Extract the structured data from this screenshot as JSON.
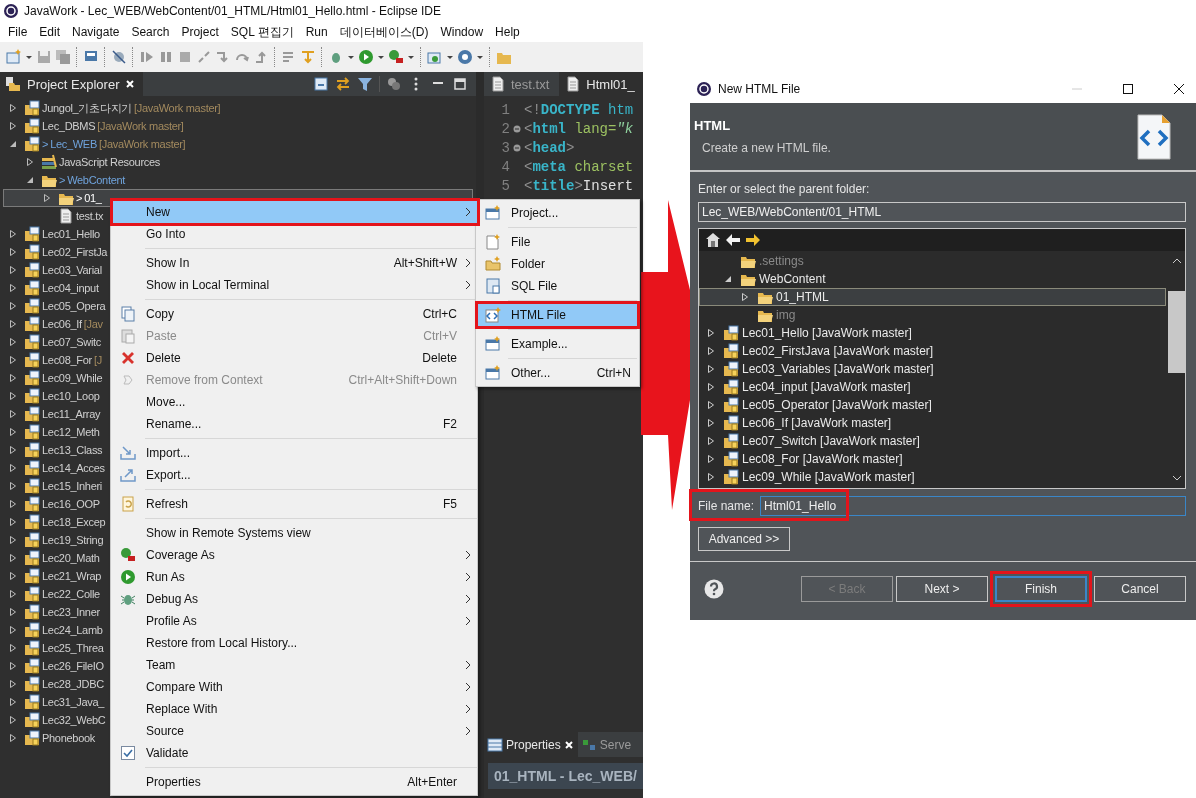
{
  "window": {
    "title": "JavaWork - Lec_WEB/WebContent/01_HTML/Html01_Hello.html - Eclipse IDE"
  },
  "menu_bar": [
    "File",
    "Edit",
    "Navigate",
    "Search",
    "Project",
    "SQL 편집기",
    "Run",
    "데이터베이스(D)",
    "Window",
    "Help"
  ],
  "explorer": {
    "tab": {
      "label": "Project Explorer",
      "selected": true
    },
    "items": [
      {
        "kind": "project",
        "label": "Jungol_기초다지기",
        "decoration": "[JavaWork master]",
        "expanded": false,
        "selected": false,
        "dirty": false
      },
      {
        "kind": "project",
        "label": "Lec_DBMS",
        "decoration": "[JavaWork master]",
        "expanded": false,
        "selected": false,
        "dirty": false
      },
      {
        "kind": "project",
        "prefix": ">",
        "label": "Lec_WEB",
        "decoration": "[JavaWork master]",
        "expanded": true,
        "selected": false,
        "dirty": true,
        "children": [
          {
            "kind": "library",
            "label": "JavaScript Resources",
            "expanded": false,
            "selected": false,
            "dirty": false
          },
          {
            "kind": "folder",
            "prefix": ">",
            "label": "WebContent",
            "expanded": true,
            "selected": false,
            "dirty": true,
            "children": [
              {
                "kind": "folder",
                "prefix": ">",
                "label": "01_",
                "expanded": false,
                "selected": true,
                "dirty": true
              },
              {
                "kind": "file",
                "label": "test.tx",
                "selected": false,
                "dirty": false
              }
            ]
          }
        ]
      },
      {
        "kind": "project",
        "label": "Lec01_Hello",
        "expanded": false,
        "selected": false,
        "dirty": false
      },
      {
        "kind": "project",
        "label": "Lec02_FirstJa",
        "expanded": false,
        "selected": false,
        "dirty": false
      },
      {
        "kind": "project",
        "label": "Lec03_Varial",
        "expanded": false,
        "selected": false,
        "dirty": false
      },
      {
        "kind": "project",
        "label": "Lec04_input",
        "expanded": false,
        "selected": false,
        "dirty": false
      },
      {
        "kind": "project",
        "label": "Lec05_Opera",
        "expanded": false,
        "selected": false,
        "dirty": false
      },
      {
        "kind": "project",
        "label": "Lec06_If",
        "decoration": "[Jav",
        "expanded": false,
        "selected": false,
        "dirty": false
      },
      {
        "kind": "project",
        "label": "Lec07_Switc",
        "expanded": false,
        "selected": false,
        "dirty": false
      },
      {
        "kind": "project",
        "label": "Lec08_For",
        "decoration": "[J",
        "expanded": false,
        "selected": false,
        "dirty": false
      },
      {
        "kind": "project",
        "label": "Lec09_While",
        "expanded": false,
        "selected": false,
        "dirty": false
      },
      {
        "kind": "project",
        "label": "Lec10_Loop",
        "expanded": false,
        "selected": false,
        "dirty": false
      },
      {
        "kind": "project",
        "label": "Lec11_Array",
        "expanded": false,
        "selected": false,
        "dirty": false
      },
      {
        "kind": "project",
        "label": "Lec12_Meth",
        "expanded": false,
        "selected": false,
        "dirty": false
      },
      {
        "kind": "project",
        "label": "Lec13_Class",
        "expanded": false,
        "selected": false,
        "dirty": false
      },
      {
        "kind": "project",
        "label": "Lec14_Acces",
        "expanded": false,
        "selected": false,
        "dirty": false
      },
      {
        "kind": "project",
        "label": "Lec15_Inheri",
        "expanded": false,
        "selected": false,
        "dirty": false
      },
      {
        "kind": "project",
        "label": "Lec16_OOP",
        "expanded": false,
        "selected": false,
        "dirty": false
      },
      {
        "kind": "project",
        "label": "Lec18_Excep",
        "expanded": false,
        "selected": false,
        "dirty": false
      },
      {
        "kind": "project",
        "label": "Lec19_String",
        "expanded": false,
        "selected": false,
        "dirty": false
      },
      {
        "kind": "project",
        "label": "Lec20_Math",
        "expanded": false,
        "selected": false,
        "dirty": false
      },
      {
        "kind": "project",
        "label": "Lec21_Wrap",
        "expanded": false,
        "selected": false,
        "dirty": false
      },
      {
        "kind": "project",
        "label": "Lec22_Colle",
        "expanded": false,
        "selected": false,
        "dirty": false
      },
      {
        "kind": "project",
        "label": "Lec23_Inner",
        "expanded": false,
        "selected": false,
        "dirty": false
      },
      {
        "kind": "project",
        "label": "Lec24_Lamb",
        "expanded": false,
        "selected": false,
        "dirty": false
      },
      {
        "kind": "project",
        "label": "Lec25_Threa",
        "expanded": false,
        "selected": false,
        "dirty": false
      },
      {
        "kind": "project",
        "label": "Lec26_FileIO",
        "expanded": false,
        "selected": false,
        "dirty": false
      },
      {
        "kind": "project",
        "label": "Lec28_JDBC",
        "expanded": false,
        "selected": false,
        "dirty": false
      },
      {
        "kind": "project",
        "label": "Lec31_Java_",
        "expanded": false,
        "selected": false,
        "dirty": false
      },
      {
        "kind": "project",
        "label": "Lec32_WebC",
        "expanded": false,
        "selected": false,
        "dirty": false
      },
      {
        "kind": "project",
        "label": "Phonebook",
        "expanded": false,
        "selected": false,
        "dirty": false
      }
    ]
  },
  "editor": {
    "tabs": [
      {
        "label": "test.txt",
        "selected": false
      },
      {
        "label": "Html01_",
        "selected": true
      }
    ],
    "lines": [
      {
        "number": "1",
        "foldable": false,
        "tokens": [
          {
            "kind": "punct",
            "text": "<!"
          },
          {
            "kind": "keyword",
            "text": "DOCTYPE"
          },
          {
            "kind": "name",
            "text": " htm"
          }
        ]
      },
      {
        "number": "2",
        "foldable": true,
        "tokens": [
          {
            "kind": "punct",
            "text": "<"
          },
          {
            "kind": "keyword",
            "text": "html"
          },
          {
            "kind": "attr",
            "text": " lang="
          },
          {
            "kind": "string",
            "text": "\"k"
          }
        ]
      },
      {
        "number": "3",
        "foldable": true,
        "tokens": [
          {
            "kind": "punct",
            "text": "<"
          },
          {
            "kind": "keyword",
            "text": "head"
          },
          {
            "kind": "punct",
            "text": ">"
          }
        ]
      },
      {
        "number": "4",
        "foldable": false,
        "tokens": [
          {
            "kind": "punct",
            "text": "<"
          },
          {
            "kind": "keyword",
            "text": "meta"
          },
          {
            "kind": "attr",
            "text": " charset"
          }
        ]
      },
      {
        "number": "5",
        "foldable": false,
        "tokens": [
          {
            "kind": "punct",
            "text": "<"
          },
          {
            "kind": "keyword",
            "text": "title"
          },
          {
            "kind": "punct",
            "text": ">"
          },
          {
            "kind": "text",
            "text": "Insert"
          }
        ]
      }
    ]
  },
  "bottom_panel": {
    "tabs": [
      {
        "label": "Properties",
        "selected": true,
        "closable": true
      },
      {
        "label": "Serve",
        "selected": false,
        "closable": false
      }
    ],
    "header": "01_HTML - Lec_WEB/"
  },
  "context_menu": {
    "items": [
      {
        "kind": "item",
        "label": "New",
        "submenu": true,
        "disabled": false,
        "selected": true,
        "annotated": true
      },
      {
        "kind": "item",
        "label": "Go Into",
        "submenu": false,
        "disabled": false,
        "selected": false
      },
      {
        "kind": "separator"
      },
      {
        "kind": "item",
        "label": "Show In",
        "shortcut": "Alt+Shift+W",
        "submenu": true,
        "disabled": false,
        "selected": false
      },
      {
        "kind": "item",
        "label": "Show in Local Terminal",
        "submenu": true,
        "disabled": false,
        "selected": false
      },
      {
        "kind": "separator"
      },
      {
        "kind": "item",
        "label": "Copy",
        "shortcut": "Ctrl+C",
        "submenu": false,
        "disabled": false,
        "selected": false
      },
      {
        "kind": "item",
        "label": "Paste",
        "shortcut": "Ctrl+V",
        "submenu": false,
        "disabled": true,
        "selected": false
      },
      {
        "kind": "item",
        "label": "Delete",
        "shortcut": "Delete",
        "submenu": false,
        "disabled": false,
        "selected": false
      },
      {
        "kind": "item",
        "label": "Remove from Context",
        "shortcut": "Ctrl+Alt+Shift+Down",
        "submenu": false,
        "disabled": true,
        "selected": false
      },
      {
        "kind": "item",
        "label": "Move...",
        "submenu": false,
        "disabled": false,
        "selected": false
      },
      {
        "kind": "item",
        "label": "Rename...",
        "shortcut": "F2",
        "submenu": false,
        "disabled": false,
        "selected": false
      },
      {
        "kind": "separator"
      },
      {
        "kind": "item",
        "label": "Import...",
        "submenu": false,
        "disabled": false,
        "selected": false
      },
      {
        "kind": "item",
        "label": "Export...",
        "submenu": false,
        "disabled": false,
        "selected": false
      },
      {
        "kind": "separator"
      },
      {
        "kind": "item",
        "label": "Refresh",
        "shortcut": "F5",
        "submenu": false,
        "disabled": false,
        "selected": false
      },
      {
        "kind": "separator"
      },
      {
        "kind": "item",
        "label": "Show in Remote Systems view",
        "submenu": false,
        "disabled": false,
        "selected": false
      },
      {
        "kind": "item",
        "label": "Coverage As",
        "submenu": true,
        "disabled": false,
        "selected": false
      },
      {
        "kind": "item",
        "label": "Run As",
        "submenu": true,
        "disabled": false,
        "selected": false
      },
      {
        "kind": "item",
        "label": "Debug As",
        "submenu": true,
        "disabled": false,
        "selected": false
      },
      {
        "kind": "item",
        "label": "Profile As",
        "submenu": true,
        "disabled": false,
        "selected": false
      },
      {
        "kind": "item",
        "label": "Restore from Local History...",
        "submenu": false,
        "disabled": false,
        "selected": false
      },
      {
        "kind": "item",
        "label": "Team",
        "submenu": true,
        "disabled": false,
        "selected": false
      },
      {
        "kind": "item",
        "label": "Compare With",
        "submenu": true,
        "disabled": false,
        "selected": false
      },
      {
        "kind": "item",
        "label": "Replace With",
        "submenu": true,
        "disabled": false,
        "selected": false
      },
      {
        "kind": "item",
        "label": "Source",
        "submenu": true,
        "disabled": false,
        "selected": false
      },
      {
        "kind": "item",
        "label": "Validate",
        "submenu": false,
        "disabled": false,
        "selected": false
      },
      {
        "kind": "separator"
      },
      {
        "kind": "item",
        "label": "Properties",
        "shortcut": "Alt+Enter",
        "submenu": false,
        "disabled": false,
        "selected": false
      }
    ]
  },
  "submenu": {
    "items": [
      {
        "kind": "item",
        "label": "Project...",
        "selected": false
      },
      {
        "kind": "separator"
      },
      {
        "kind": "item",
        "label": "File",
        "selected": false
      },
      {
        "kind": "item",
        "label": "Folder",
        "selected": false
      },
      {
        "kind": "item",
        "label": "SQL File",
        "selected": false
      },
      {
        "kind": "separator"
      },
      {
        "kind": "item",
        "label": "HTML File",
        "selected": true,
        "annotated": true
      },
      {
        "kind": "separator"
      },
      {
        "kind": "item",
        "label": "Example...",
        "selected": false
      },
      {
        "kind": "separator"
      },
      {
        "kind": "item",
        "label": "Other...",
        "shortcut": "Ctrl+N",
        "selected": false
      }
    ]
  },
  "dialog": {
    "title": "New HTML File",
    "heading": "HTML",
    "description": "Create a new HTML file.",
    "folder_label": "Enter or select the parent folder:",
    "folder_value": "Lec_WEB/WebContent/01_HTML",
    "tree": [
      {
        "kind": "offscreen",
        "children": [
          {
            "kind": "folder",
            "label": ".settings",
            "dimmed": true,
            "selected": false
          },
          {
            "kind": "folder",
            "label": "WebContent",
            "dimmed": false,
            "selected": false,
            "expanded": true,
            "children": [
              {
                "kind": "folder",
                "label": "01_HTML",
                "dimmed": false,
                "selected": true,
                "expanded": false
              },
              {
                "kind": "folder",
                "label": "img",
                "dimmed": true,
                "selected": false
              }
            ]
          }
        ]
      },
      {
        "kind": "project",
        "label": "Lec01_Hello [JavaWork master]",
        "dimmed": false,
        "selected": false,
        "expanded": false
      },
      {
        "kind": "project",
        "label": "Lec02_FirstJava [JavaWork master]",
        "dimmed": false,
        "selected": false,
        "expanded": false
      },
      {
        "kind": "project",
        "label": "Lec03_Variables [JavaWork master]",
        "dimmed": false,
        "selected": false,
        "expanded": false
      },
      {
        "kind": "project",
        "label": "Lec04_input [JavaWork master]",
        "dimmed": false,
        "selected": false,
        "expanded": false
      },
      {
        "kind": "project",
        "label": "Lec05_Operator [JavaWork master]",
        "dimmed": false,
        "selected": false,
        "expanded": false
      },
      {
        "kind": "project",
        "label": "Lec06_If [JavaWork master]",
        "dimmed": false,
        "selected": false,
        "expanded": false
      },
      {
        "kind": "project",
        "label": "Lec07_Switch [JavaWork master]",
        "dimmed": false,
        "selected": false,
        "expanded": false
      },
      {
        "kind": "project",
        "label": "Lec08_For [JavaWork master]",
        "dimmed": false,
        "selected": false,
        "expanded": false
      },
      {
        "kind": "project",
        "label": "Lec09_While [JavaWork master]",
        "dimmed": false,
        "selected": false,
        "expanded": false
      }
    ],
    "file_name": {
      "label": "File name:",
      "value": "Html01_Hello",
      "annotated": true
    },
    "advanced_button": "Advanced >>",
    "buttons": [
      {
        "label": "< Back",
        "disabled": true,
        "default": false
      },
      {
        "label": "Next >",
        "disabled": false,
        "default": false
      },
      {
        "label": "Finish",
        "disabled": false,
        "default": true,
        "annotated": true
      },
      {
        "label": "Cancel",
        "disabled": false,
        "default": false
      }
    ]
  }
}
